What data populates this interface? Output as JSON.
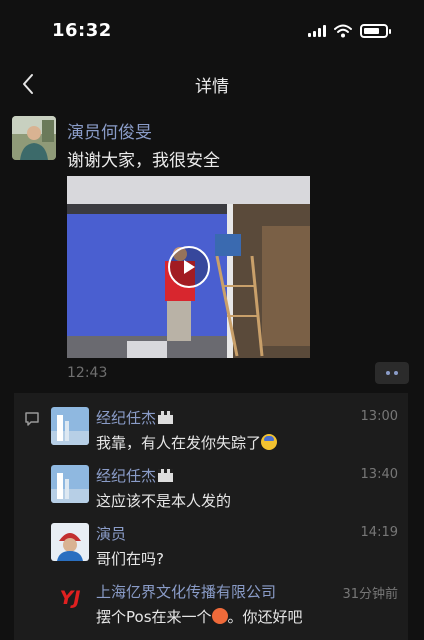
{
  "status_bar": {
    "time": "16:32",
    "icons": [
      "signal-icon",
      "wifi-icon",
      "battery-icon"
    ],
    "battery_level": 0.75
  },
  "nav": {
    "back_icon": "chevron-left-icon",
    "title": "详情"
  },
  "post": {
    "author": "演员何俊旻",
    "text": "谢谢大家，我很安全",
    "video_icon": "play-icon",
    "time": "12:43",
    "more_icon": "more-dots-icon"
  },
  "comments": [
    {
      "name": "经纪任杰",
      "has_badge": true,
      "time": "13:00",
      "text": "我靠，有人在发你失踪了",
      "emoji": "fearful-face"
    },
    {
      "name": "经纪任杰",
      "has_badge": true,
      "time": "13:40",
      "text": "这应该不是本人发的"
    },
    {
      "name": "演员",
      "has_badge": false,
      "time": "14:19",
      "text": "哥们在吗?"
    },
    {
      "name": "上海亿界文化传播有限公司",
      "has_badge": false,
      "time": "31分钟前",
      "text_before": "摆个Pos在来一个",
      "emoji": "angry-face",
      "text_after": "。你还好吧",
      "logo_text": "YJ"
    }
  ],
  "colors": {
    "background": "#111111",
    "name_link": "#8a9cc8",
    "comment_bg": "#1c1c1c"
  }
}
